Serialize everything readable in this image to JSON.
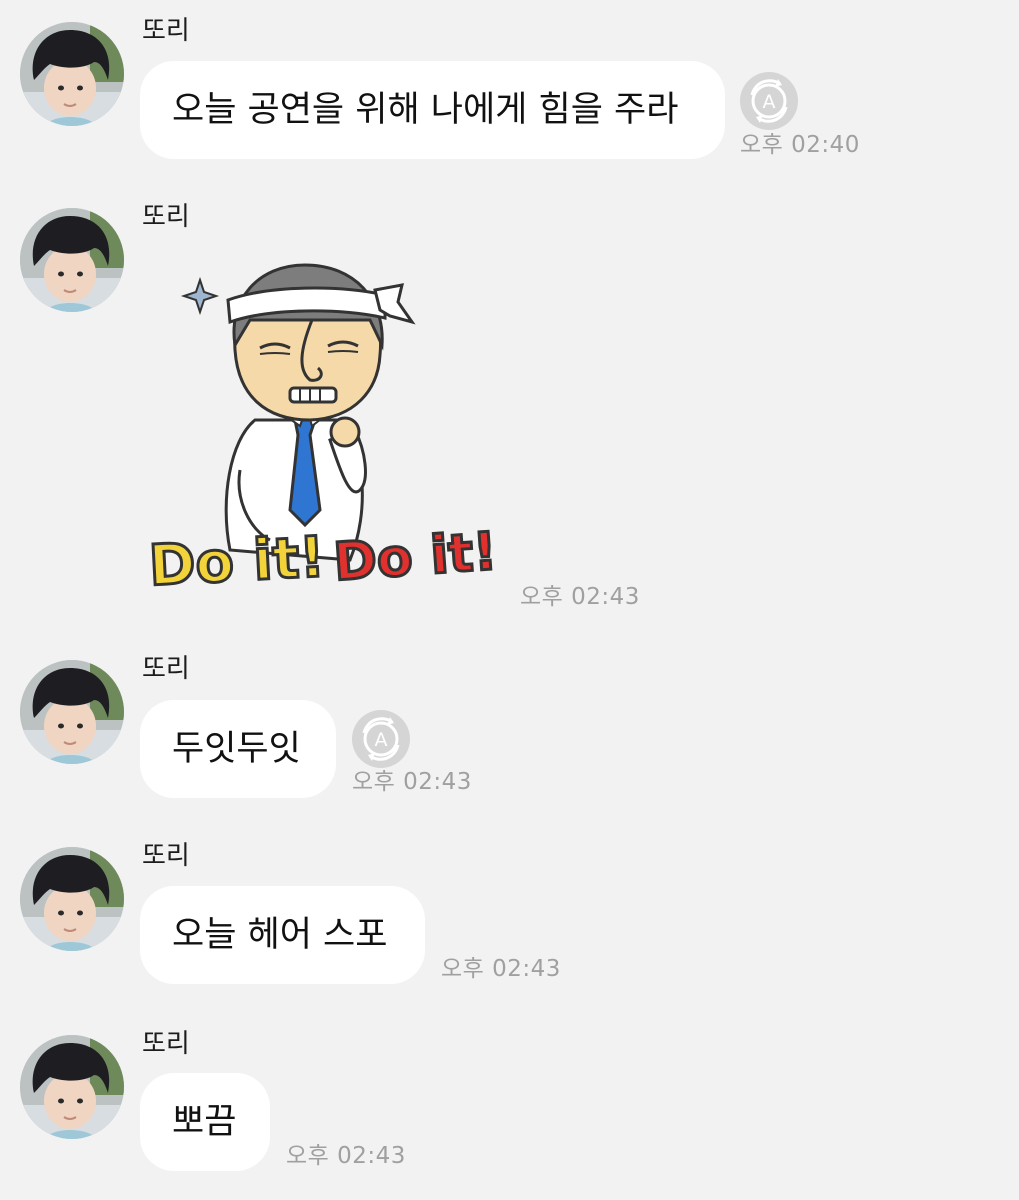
{
  "chat": {
    "messages": [
      {
        "sender": "또리",
        "text": "오늘 공연을 위해 나에게 힘을 주라",
        "time": "오후 02:40",
        "has_translate": true
      },
      {
        "sender": "또리",
        "type": "sticker",
        "sticker_text": "Do it! Do it!",
        "time": "오후 02:43",
        "has_translate": false
      },
      {
        "sender": "또리",
        "text": "두잇두잇",
        "time": "오후 02:43",
        "has_translate": true
      },
      {
        "sender": "또리",
        "text": "오늘 헤어 스포",
        "time": "오후 02:43",
        "has_translate": false
      },
      {
        "sender": "또리",
        "text": "뽀끔",
        "time": "오후 02:43",
        "has_translate": false
      }
    ]
  },
  "icons": {
    "translate": "translate-a-icon",
    "avatar": "profile-photo"
  },
  "colors": {
    "background": "#f2f2f2",
    "bubble": "#ffffff",
    "time_text": "#a0a0a0",
    "translate_button": "#d5d5d5",
    "sticker_yellow": "#f2d43a",
    "sticker_red": "#e0312e",
    "sticker_tie": "#2f76d2"
  }
}
